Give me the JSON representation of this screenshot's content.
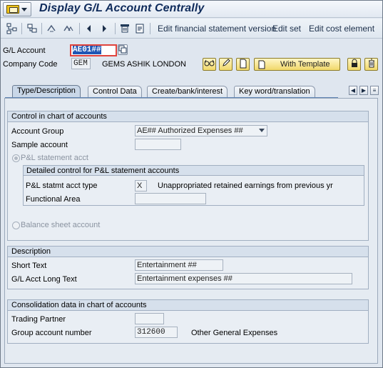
{
  "window": {
    "title": "Display G/L Account Centrally"
  },
  "toolbar": {
    "edit_fin_stmt_version": "Edit financial statement version",
    "edit_set": "Edit set",
    "edit_cost_element": "Edit cost element"
  },
  "header": {
    "gl_account_label": "G/L Account",
    "gl_account_value": "AE01##",
    "company_code_label": "Company Code",
    "company_code_value": "GEM",
    "company_name": "GEMS ASHIK LONDON",
    "with_template_label": "With Template"
  },
  "tabs": [
    {
      "label": "Type/Description",
      "active": true
    },
    {
      "label": "Control Data",
      "active": false
    },
    {
      "label": "Create/bank/interest",
      "active": false
    },
    {
      "label": "Key word/translation",
      "active": false
    }
  ],
  "control_coa": {
    "title": "Control in chart of accounts",
    "account_group_label": "Account Group",
    "account_group_value": "AE## Authorized Expenses ##",
    "sample_account_label": "Sample account",
    "sample_account_value": "",
    "pl_radio_label": "P&L statement acct",
    "detailed_title": "Detailed control for P&L statement accounts",
    "pl_type_label": "P&L statmt acct type",
    "pl_type_value": "X",
    "pl_type_desc": "Unappropriated retained earnings from previous yr",
    "functional_area_label": "Functional Area",
    "functional_area_value": "",
    "balance_radio_label": "Balance sheet account"
  },
  "description": {
    "title": "Description",
    "short_text_label": "Short Text",
    "short_text_value": "Entertainment ##",
    "long_text_label": "G/L Acct Long Text",
    "long_text_value": "Entertainment expenses ##"
  },
  "consolidation": {
    "title": "Consolidation data in chart of accounts",
    "trading_partner_label": "Trading Partner",
    "trading_partner_value": "",
    "group_account_label": "Group account number",
    "group_account_value": "312600",
    "group_account_desc": "Other General Expenses"
  },
  "colors": {
    "title_text": "#0e2a5a",
    "active_tab_line": "#5f84b4",
    "focus_border": "#e0433c",
    "selection": "#1f56b4"
  }
}
